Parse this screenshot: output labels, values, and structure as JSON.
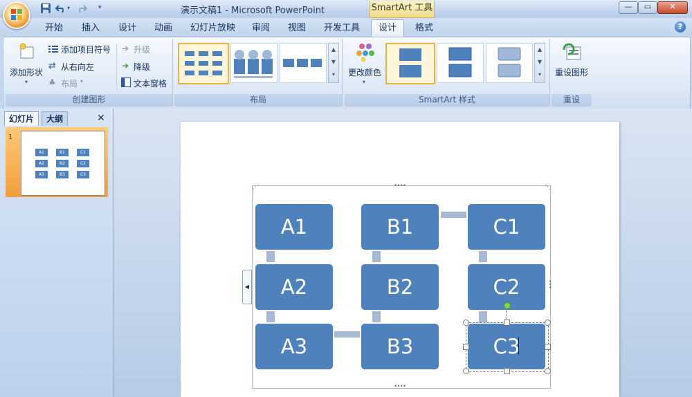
{
  "window": {
    "title": "演示文稿1 - Microsoft PowerPoint",
    "context_tab": "SmartArt 工具"
  },
  "window_controls": {
    "minimize": "—",
    "restore": "▭",
    "close": "✕"
  },
  "tabs": [
    {
      "label": "开始"
    },
    {
      "label": "插入"
    },
    {
      "label": "设计"
    },
    {
      "label": "动画"
    },
    {
      "label": "幻灯片放映"
    },
    {
      "label": "审阅"
    },
    {
      "label": "视图"
    },
    {
      "label": "开发工具"
    },
    {
      "label": "设计",
      "active": true
    },
    {
      "label": "格式"
    }
  ],
  "help": "?",
  "ribbon": {
    "create_graphic": {
      "label": "创建图形",
      "add_shape": "添加形状",
      "add_bullet": "添加项目符号",
      "right_to_left": "从右向左",
      "layout": "布局",
      "promote": "升级",
      "demote": "降级",
      "text_pane": "文本窗格"
    },
    "layouts": {
      "label": "布局"
    },
    "styles": {
      "label": "SmartArt 样式",
      "change_colors": "更改颜色"
    },
    "reset": {
      "label": "重设",
      "reset_graphic": "重设图形"
    }
  },
  "left_pane": {
    "tab_slides": "幻灯片",
    "tab_outline": "大纲",
    "close": "✕",
    "slide_number": "1"
  },
  "smartart": {
    "nodes": [
      {
        "text": "A1"
      },
      {
        "text": "A2"
      },
      {
        "text": "A3"
      },
      {
        "text": "B1"
      },
      {
        "text": "B2"
      },
      {
        "text": "B3"
      },
      {
        "text": "C1"
      },
      {
        "text": "C2"
      },
      {
        "text": "C3"
      }
    ],
    "node_color": "#4f81bd",
    "connector_color": "#a7b9d3",
    "selected_node": "C3"
  }
}
